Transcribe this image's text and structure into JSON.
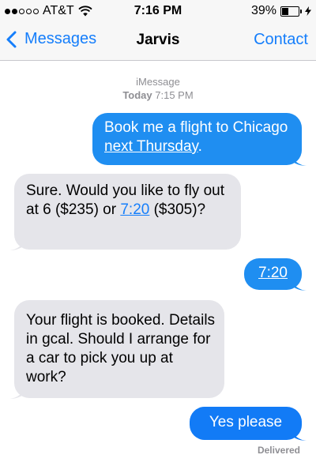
{
  "status_bar": {
    "carrier": "AT&T",
    "signal_bars": 2,
    "signal_total": 5,
    "time": "7:16 PM",
    "battery_pct": "39%",
    "battery_level": 0.39,
    "wifi_icon": "wifi-icon",
    "charge_icon": "lightning-bolt-icon"
  },
  "nav": {
    "back_label": "Messages",
    "back_icon": "chevron-left-icon",
    "title": "Jarvis",
    "contact_label": "Contact"
  },
  "thread": {
    "service": "iMessage",
    "day": "Today",
    "time": "7:15 PM"
  },
  "messages": [
    {
      "from": "me",
      "parts": [
        "Book me a flight to Chicago ",
        "next Thursday",
        "."
      ]
    },
    {
      "from": "them",
      "parts": [
        "Sure. Would you like to fly out at 6 ($235) or ",
        "7:20",
        " ($305)?"
      ]
    },
    {
      "from": "me",
      "parts": [
        "7:20"
      ]
    },
    {
      "from": "them",
      "parts": [
        "Your flight is booked. Details in gcal. Should I arrange for a car to pick you up at work?"
      ]
    },
    {
      "from": "me",
      "parts": [
        "Yes please"
      ]
    }
  ],
  "delivery_status": "Delivered",
  "colors": {
    "outgoing_bubble": "#1f8ef1",
    "incoming_bubble": "#e5e5ea",
    "accent": "#157efb",
    "meta_gray": "#8e8e93"
  }
}
